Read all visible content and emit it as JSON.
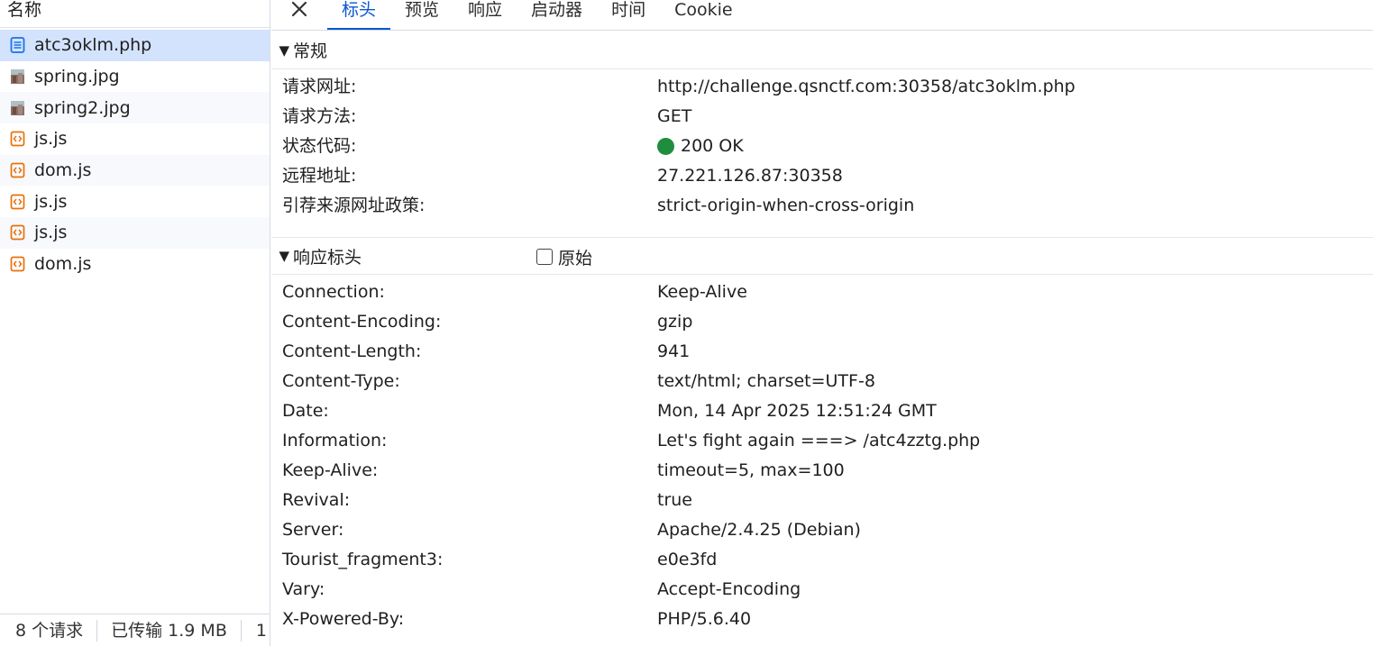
{
  "left": {
    "header": "名称",
    "files": [
      {
        "name": "atc3oklm.php",
        "icon": "document-icon",
        "selected": true
      },
      {
        "name": "spring.jpg",
        "icon": "image-icon",
        "selected": false
      },
      {
        "name": "spring2.jpg",
        "icon": "image-icon",
        "selected": false
      },
      {
        "name": "js.js",
        "icon": "script-icon",
        "selected": false
      },
      {
        "name": "dom.js",
        "icon": "script-icon",
        "selected": false
      },
      {
        "name": "js.js",
        "icon": "script-icon",
        "selected": false
      },
      {
        "name": "js.js",
        "icon": "script-icon",
        "selected": false
      },
      {
        "name": "dom.js",
        "icon": "script-icon",
        "selected": false
      }
    ],
    "footer": {
      "requests": "8 个请求",
      "transferred": "已传输 1.9 MB",
      "more": "1"
    }
  },
  "tabs": {
    "close_icon": "close-icon",
    "items": [
      {
        "label": "标头",
        "active": true
      },
      {
        "label": "预览",
        "active": false
      },
      {
        "label": "响应",
        "active": false
      },
      {
        "label": "启动器",
        "active": false
      },
      {
        "label": "时间",
        "active": false
      },
      {
        "label": "Cookie",
        "active": false
      }
    ],
    "active_color": "#0b57d0"
  },
  "general": {
    "title": "常规",
    "rows": [
      {
        "key": "请求网址:",
        "value": "http://challenge.qsnctf.com:30358/atc3oklm.php"
      },
      {
        "key": "请求方法:",
        "value": "GET"
      },
      {
        "key": "状态代码:",
        "value": "200 OK",
        "status_color": "#1e8e3e"
      },
      {
        "key": "远程地址:",
        "value": "27.221.126.87:30358"
      },
      {
        "key": "引荐来源网址政策:",
        "value": "strict-origin-when-cross-origin"
      }
    ]
  },
  "response_headers": {
    "title": "响应标头",
    "raw_label": "原始",
    "raw_checked": false,
    "rows": [
      {
        "key": "Connection:",
        "value": "Keep-Alive"
      },
      {
        "key": "Content-Encoding:",
        "value": "gzip"
      },
      {
        "key": "Content-Length:",
        "value": "941"
      },
      {
        "key": "Content-Type:",
        "value": "text/html; charset=UTF-8"
      },
      {
        "key": "Date:",
        "value": "Mon, 14 Apr 2025 12:51:24 GMT"
      },
      {
        "key": "Information:",
        "value": "Let's fight again ===> /atc4zztg.php"
      },
      {
        "key": "Keep-Alive:",
        "value": "timeout=5, max=100"
      },
      {
        "key": "Revival:",
        "value": "true"
      },
      {
        "key": "Server:",
        "value": "Apache/2.4.25 (Debian)"
      },
      {
        "key": "Tourist_fragment3:",
        "value": "e0e3fd"
      },
      {
        "key": "Vary:",
        "value": "Accept-Encoding"
      },
      {
        "key": "X-Powered-By:",
        "value": "PHP/5.6.40"
      }
    ]
  }
}
